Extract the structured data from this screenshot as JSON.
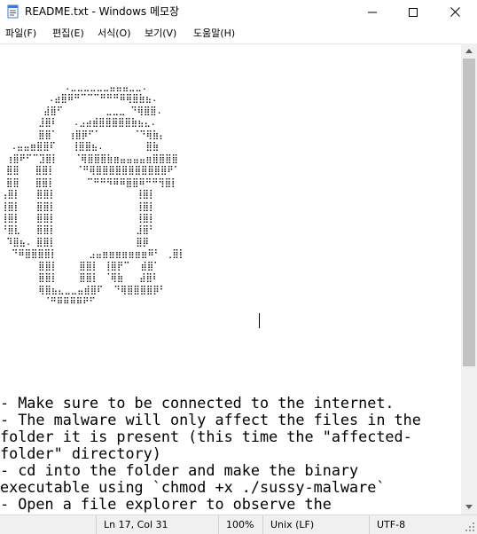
{
  "window": {
    "title": "README.txt - Windows 메모장",
    "minimize_glyph": "—",
    "maximize_glyph": "☐",
    "close_glyph": "✕"
  },
  "menu": {
    "items": [
      {
        "label": "파일(F)"
      },
      {
        "label": "편집(E)"
      },
      {
        "label": "서식(O)"
      },
      {
        "label": "보기(V)"
      },
      {
        "label": "도움말(H)"
      }
    ]
  },
  "document": {
    "ascii_art": "            .⣀⣀⣀⣀⣀⣀⣤⣤⣤⣀⣀.\n         .⣴⣿⠿⠛⠉⠉⠉⠛⠛⠛⠿⢿⣿⣷⣦.\n        ⣼⣿⠋        ⣀⣀⣀ ⠙⢿⣿⣿.\n       ⣸⣿⠇   .⣠⣴⣾⣿⣿⣿⣿⣿⣷⣦⣄.\n       ⣿⣿⠁  ⢰⣿⡿⠋⠁      ⠈⠙⢿⣷⡄\n  .⣤⣤⣶⣿⣿⠏   ⢸⣿⣿⣦.        ⣿⣷\n ⢰⣿⠟⠋⠉⣹⣿⡇   ⠈⢿⣿⣿⣿⣷⣶⣤⣤⣤⣤⣶⣿⣿⣿⣿\n ⣿⣿   ⣿⣿⡇    ⠈⠛⢿⣿⣿⣿⣿⣿⣿⣿⣿⣿⣿⣿⠟⠁\n ⣿⣿   ⣿⣿⡇      ⠉⠛⠛⠻⠿⠿⣿⣿⠿⠛⠛⢻⣿⡇\n⢠⣿⡇   ⣿⣿⡇               ⢸⣿⡇\n⢸⣿⡇   ⣿⣿⡇               ⢸⣿⡇\n⢸⣿⡇   ⣿⣿⡇               ⢸⣿⡇\n⠘⣿⣇   ⣿⣿⡇               ⣸⣿⠃\n ⠹⣿⣦. ⣿⣿⡇               ⣿⡿\n  ⠙⠿⣿⣿⣿⣿⡇      ⣠⣤⣶⣶⣶⣶⣶⣶⣶⠿⠃ ⢀⣿⡇\n       ⣿⣿⡇    ⣿⣿⡇ ⢸⣿⡟⠉  ⣾⣿⠁\n       ⣿⣿⡇    ⣿⣿⡇ ⠈⢿⣷   ⣼⣿⠇\n       ⢿⣿⣦⣄⣀⣀⣤⣾⣿⠏  ⠙⢿⣿⣿⣿⣿⡿⠃\n        ⠈⠛⠿⠿⠿⠿⠟⠋       ",
    "instructions": "- Make sure to be connected to the internet.\n- The malware will only affect the files in the\nfolder it is present (this time the \"affected-\nfolder\" directory)\n- cd into the folder and make the binary\nexecutable using `chmod +x ./sussy-malware`\n- Open a file explorer to observe the"
  },
  "status": {
    "position": "Ln 17, Col 31",
    "zoom": "100%",
    "line_ending": "Unix (LF)",
    "encoding": "UTF-8"
  },
  "icons": [
    "notepad-icon",
    "minimize-icon",
    "maximize-icon",
    "close-icon",
    "scroll-up-icon",
    "scroll-down-icon",
    "resize-grip-icon"
  ],
  "colors": {
    "window_bg": "#ffffff",
    "statusbar_bg": "#f0f0f0",
    "scrollbar_bg": "#f0f0f0",
    "scroll_thumb": "#c2c2c2",
    "text": "#000000"
  }
}
